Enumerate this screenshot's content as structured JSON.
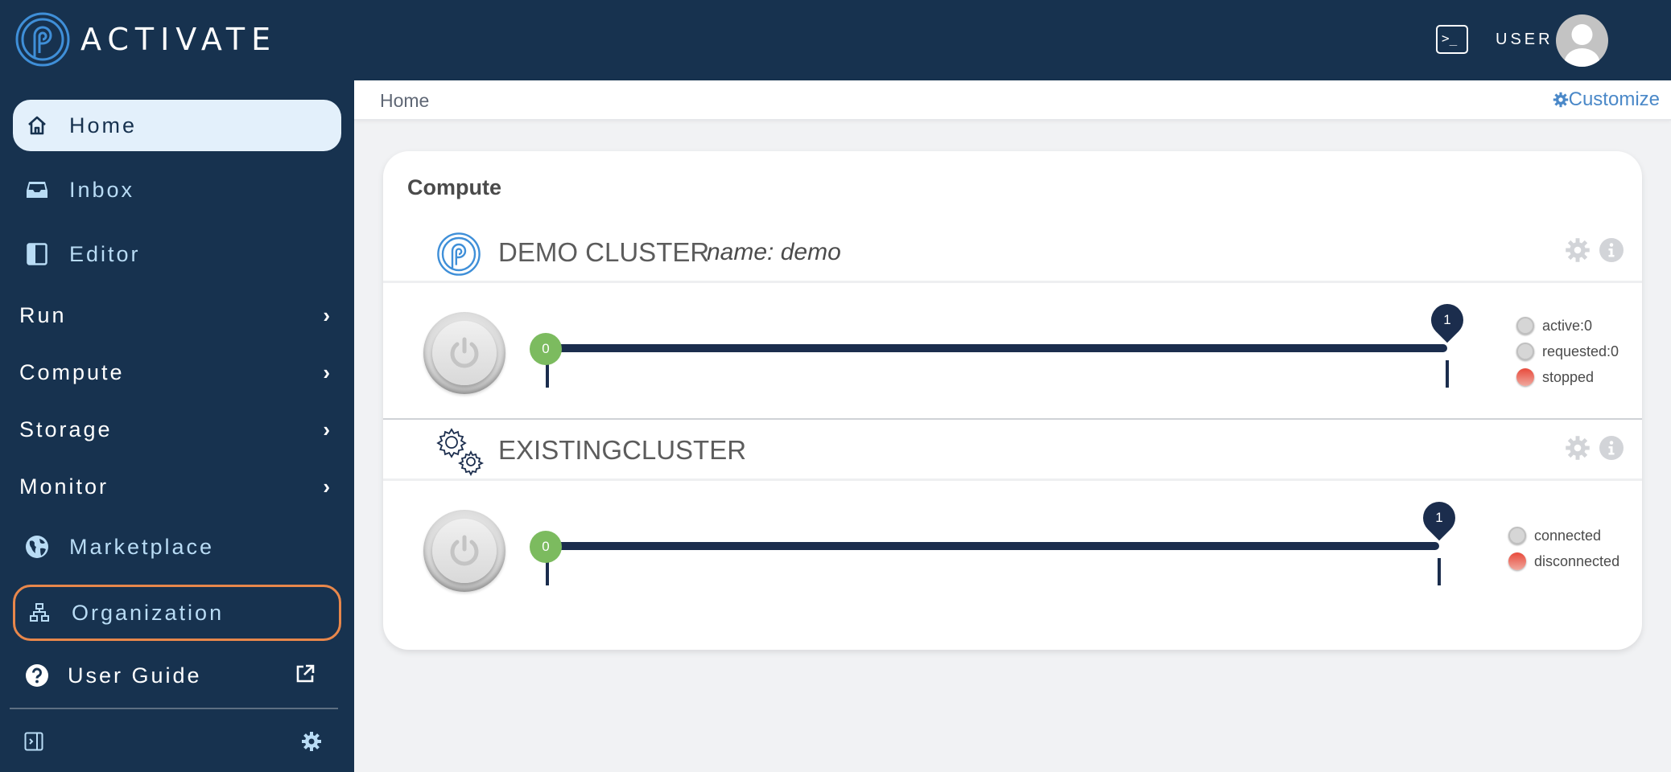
{
  "app": {
    "brand": "ACTIVATE",
    "user_label": "USER",
    "colors": {
      "primary_dark": "#17324f",
      "accent_blue": "#4a88c8",
      "highlight_orange": "#e8874b",
      "slider_min_green": "#7cbb5f",
      "status_red": "#e84a3b"
    }
  },
  "topbar": {
    "terminal_icon": "terminal-icon",
    "avatar_icon": "user-avatar-icon"
  },
  "sidebar": {
    "items": [
      {
        "label": "Home",
        "icon": "home-icon",
        "active": true
      },
      {
        "label": "Inbox",
        "icon": "inbox-icon"
      },
      {
        "label": "Editor",
        "icon": "editor-icon"
      },
      {
        "label": "Run",
        "icon": "chevron-right-icon",
        "expandable": true
      },
      {
        "label": "Compute",
        "icon": "chevron-right-icon",
        "expandable": true
      },
      {
        "label": "Storage",
        "icon": "chevron-right-icon",
        "expandable": true
      },
      {
        "label": "Monitor",
        "icon": "chevron-right-icon",
        "expandable": true
      },
      {
        "label": "Marketplace",
        "icon": "globe-icon"
      },
      {
        "label": "Organization",
        "icon": "sitemap-icon",
        "highlighted": true
      },
      {
        "label": "User Guide",
        "icon": "question-circle-icon",
        "external": true
      }
    ],
    "footer": {
      "collapse_icon": "sidebar-expand-icon",
      "settings_icon": "gear-icon"
    }
  },
  "breadcrumb": {
    "current": "Home",
    "customize_label": "Customize"
  },
  "compute_card": {
    "title": "Compute",
    "clusters": [
      {
        "name": "DEMO CLUSTER",
        "subtitle": "name: demo",
        "icon": "activate-logo-icon",
        "slider": {
          "min": 0,
          "max": 1
        },
        "status": [
          {
            "label": "active:0",
            "state": "off"
          },
          {
            "label": "requested:0",
            "state": "off"
          },
          {
            "label": "stopped",
            "state": "red"
          }
        ]
      },
      {
        "name": "EXISTINGCLUSTER",
        "subtitle": "",
        "icon": "gears-icon",
        "slider": {
          "min": 0,
          "max": 1
        },
        "status": [
          {
            "label": "connected",
            "state": "off"
          },
          {
            "label": "disconnected",
            "state": "red"
          }
        ]
      }
    ]
  }
}
